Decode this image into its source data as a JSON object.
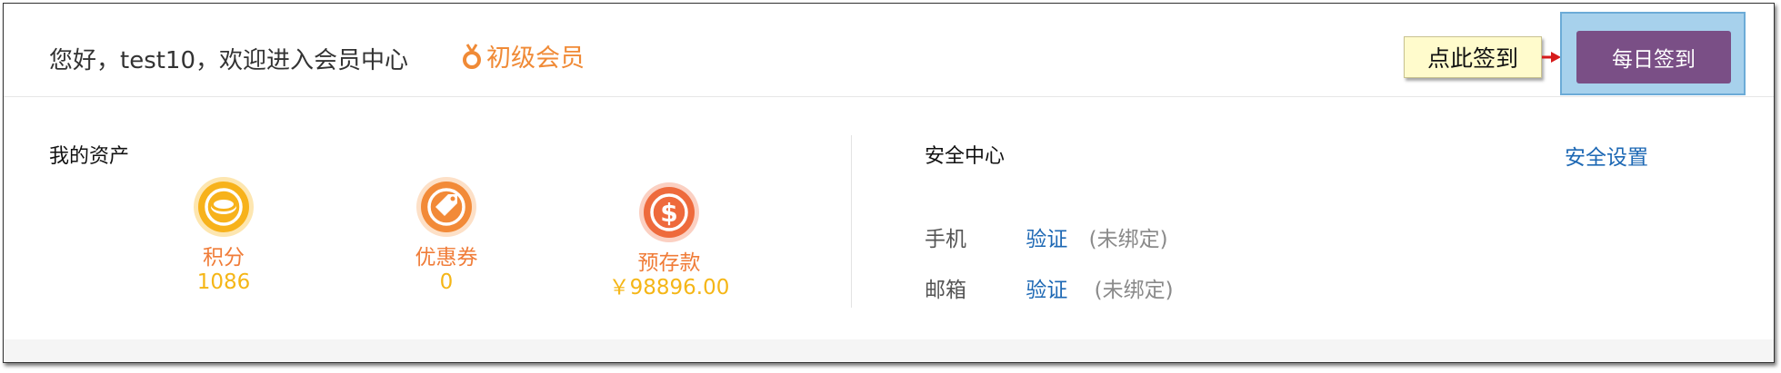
{
  "header": {
    "greeting": "您好，test10，欢迎进入会员中心",
    "level_label": "初级会员",
    "tooltip": "点此签到",
    "checkin_label": "每日签到"
  },
  "assets": {
    "title": "我的资产",
    "items": [
      {
        "label": "积分",
        "value": "1086",
        "icon": "coin-icon"
      },
      {
        "label": "优惠券",
        "value": "0",
        "icon": "tag-icon"
      },
      {
        "label": "预存款",
        "value": "￥98896.00",
        "icon": "dollar-icon"
      }
    ]
  },
  "security": {
    "title": "安全中心",
    "settings_label": "安全设置",
    "rows": [
      {
        "label": "手机",
        "link": "验证",
        "status": "(未绑定)"
      },
      {
        "label": "邮箱",
        "link": "验证",
        "status": "(未绑定)"
      }
    ]
  },
  "colors": {
    "accent_orange": "#f07c38",
    "value_yellow": "#f5b617",
    "link_blue": "#1d68b4",
    "checkin_purple": "#7a4f86"
  }
}
